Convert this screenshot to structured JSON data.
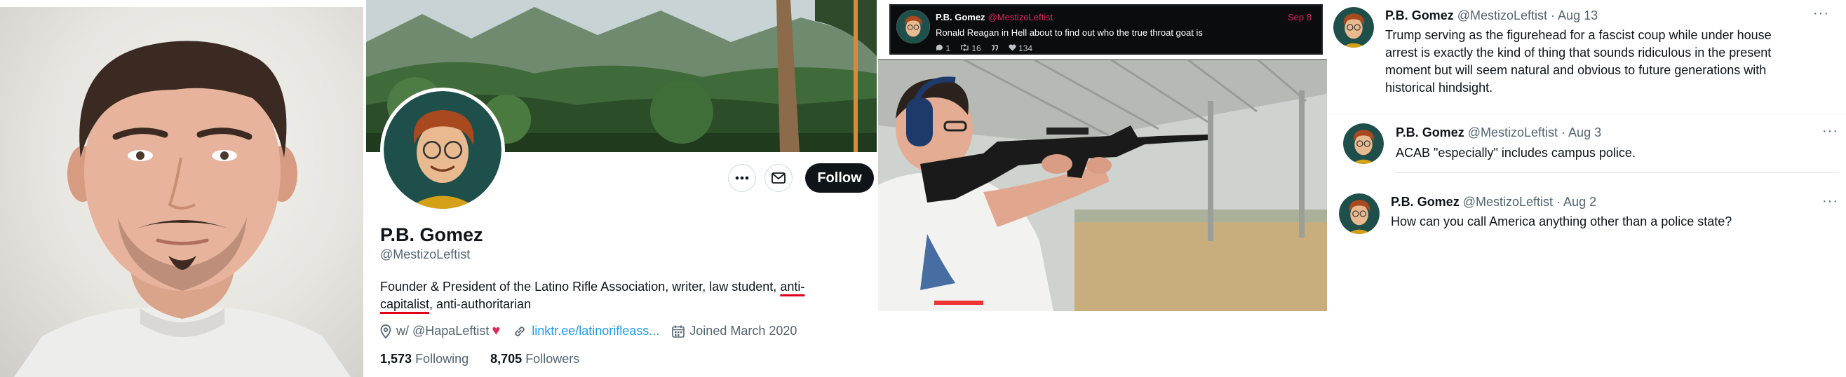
{
  "profile": {
    "display_name": "P.B. Gomez",
    "handle": "@MestizoLeftist",
    "bio_before": "Founder & President of the Latino Rifle Association, writer, law student, ",
    "bio_underlined_1": "anti-",
    "bio_underlined_2": "capitalist",
    "bio_after": ", anti-authoritarian",
    "location": "w/ @HapaLeftist",
    "location_emoji": "♥",
    "website": "linktr.ee/latinorifleass...",
    "joined": "Joined March 2020",
    "following_count": "1,573",
    "following_label": "Following",
    "followers_count": "8,705",
    "followers_label": "Followers",
    "follow_label": "Follow",
    "icons": [
      "more-icon",
      "envelope-icon",
      "location-pin-icon",
      "link-icon",
      "calendar-icon"
    ]
  },
  "embedded_tweet": {
    "name": "P.B. Gomez",
    "handle": "@MestizoLeftist",
    "date": "Sep 8",
    "text": "Ronald Reagan in Hell about to find out who the true throat goat is",
    "replies": "1",
    "retweets": "16",
    "likes": "134",
    "theme_colors": {
      "background": "#0b0c0e",
      "accent": "#e0245e"
    }
  },
  "tweets": [
    {
      "name": "P.B. Gomez",
      "handle": "@MestizoLeftist",
      "date": "· Aug 13",
      "text": "Trump serving as the figurehead for a fascist coup while under house arrest is exactly the kind of thing that sounds ridiculous in the present moment but will seem natural and obvious to future generations with historical hindsight."
    },
    {
      "name": "P.B. Gomez",
      "handle": "@MestizoLeftist",
      "date": "· Aug 3",
      "text": "ACAB \"especially\" includes campus police."
    },
    {
      "name": "P.B. Gomez",
      "handle": "@MestizoLeftist",
      "date": "· Aug 2",
      "text": "How can you call America anything other than a police state?"
    }
  ],
  "colors": {
    "accent_blue": "#1d9bf0",
    "underline_red": "#e0001a",
    "text_primary": "#0f1419",
    "text_secondary": "#536471"
  }
}
